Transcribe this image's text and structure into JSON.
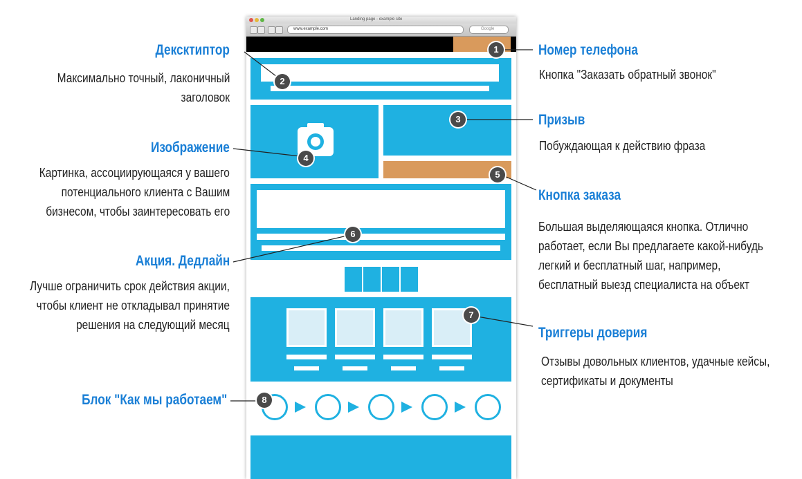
{
  "browser": {
    "window_title": "Landing page - example site",
    "url": "www.example.com",
    "search_placeholder": "Google"
  },
  "callouts": {
    "descriptor": {
      "number": "2",
      "title": "Дексктиптор",
      "desc_line1": "Максимально точный, лаконичный",
      "desc_line2": "заголовок"
    },
    "image": {
      "number": "4",
      "title": "Изображение",
      "desc_line1": "Картинка, ассоциирующаяся у вашего",
      "desc_line2": "потенциального клиента с Вашим",
      "desc_line3": "бизнесом, чтобы заинтересовать его"
    },
    "promo": {
      "number": "6",
      "title": "Акция. Дедлайн",
      "desc_line1": "Лучше ограничить срок действия акции,",
      "desc_line2": "чтобы клиент не откладывал принятие",
      "desc_line3": "решения на следующий месяц"
    },
    "how_we_work": {
      "number": "8",
      "title": "Блок \"Как мы работаем\""
    },
    "phone": {
      "number": "1",
      "title": "Номер телефона",
      "desc_line1": "Кнопка \"Заказать обратный звонок\""
    },
    "call_to_action": {
      "number": "3",
      "title": "Призыв",
      "desc_line1": "Побуждающая к действию фраза"
    },
    "order_button": {
      "number": "5",
      "title": "Кнопка заказа",
      "desc_line1": "Большая выделяющаяся кнопка. Отлично",
      "desc_line2": "работает, если Вы предлагаете какой-нибудь",
      "desc_line3": "легкий и бесплатный шаг, например,",
      "desc_line4": "бесплатный выезд специалиста на объект"
    },
    "trust": {
      "number": "7",
      "title": "Триггеры доверия",
      "desc_line1": "Отзывы довольных клиентов, удачные кейсы,",
      "desc_line2": "сертификаты и документы"
    }
  },
  "colors": {
    "accent": "#1fb1e1",
    "title": "#1a7fd6",
    "button": "#d99a5c"
  }
}
